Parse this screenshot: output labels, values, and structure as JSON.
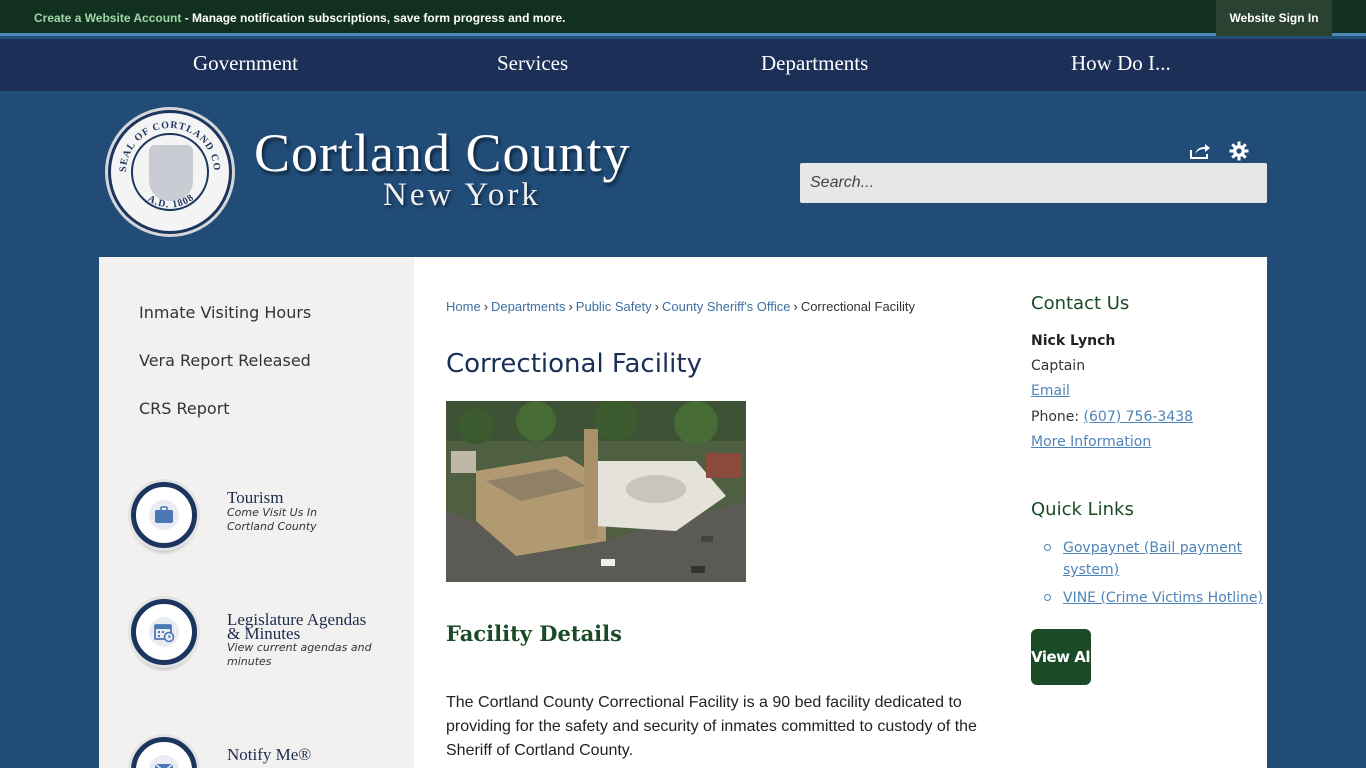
{
  "topbar": {
    "create_account_link": "Create a Website Account",
    "create_account_text": " - Manage notification subscriptions, save form progress and more.",
    "sign_in_label": "Website Sign In"
  },
  "nav": {
    "items": [
      "Government",
      "Services",
      "Departments",
      "How Do I..."
    ]
  },
  "header": {
    "seal_text": "SEAL OF CORTLAND COUNTY N.Y. A.D. 1808",
    "title": "Cortland County",
    "subtitle": "New York",
    "share_icon": "share-icon",
    "settings_icon": "gear-icon",
    "search_placeholder": "Search..."
  },
  "sidebar": {
    "links": [
      "Inmate Visiting Hours",
      "Vera Report Released",
      "CRS Report"
    ],
    "features": [
      {
        "title": "Tourism",
        "desc_line1": "Come Visit Us In",
        "desc_line2": "Cortland County",
        "icon": "suitcase-icon"
      },
      {
        "title": "Legislature Agendas",
        "title_line2": "& Minutes",
        "desc_line1": "View current agendas and",
        "desc_line2": "minutes",
        "icon": "calendar-icon"
      },
      {
        "title": "Notify Me®",
        "icon": "envelope-icon"
      }
    ]
  },
  "breadcrumb": {
    "items": [
      "Home",
      "Departments",
      "Public Safety",
      "County Sheriff's Office"
    ],
    "current": "Correctional Facility"
  },
  "content": {
    "title": "Correctional Facility",
    "section_heading": "Facility Details",
    "paragraph": "The Cortland County Correctional Facility is a 90 bed facility dedicated to providing for the safety and security of inmates committed to custody of the Sheriff of Cortland County."
  },
  "contact": {
    "heading": "Contact Us",
    "name": "Nick Lynch",
    "role": "Captain",
    "email_label": "Email",
    "phone_label": "Phone: ",
    "phone": "(607) 756-3438",
    "more_info": "More Information"
  },
  "quick_links": {
    "heading": "Quick Links",
    "item1_line1": "Govpaynet (Bail payment",
    "item1_line2": "system)",
    "item2": "VINE (Crime Victims Hotline)",
    "view_all": "View All"
  }
}
